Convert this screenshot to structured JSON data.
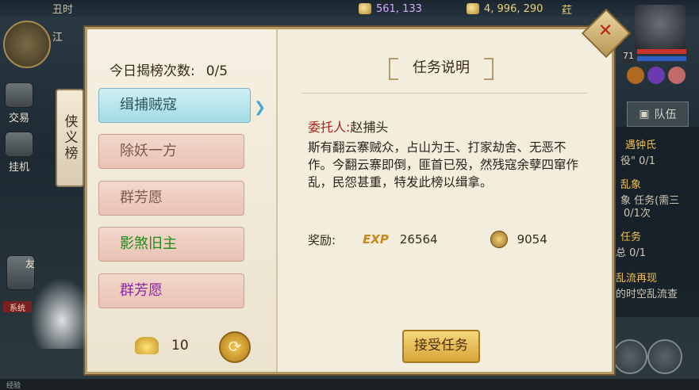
{
  "hud": {
    "clock": "丑时",
    "silver": "561, 133",
    "gold": "4, 996, 290",
    "extra_icon": "荭",
    "location": "江",
    "level": "71",
    "left_buttons": [
      {
        "label": "交易"
      },
      {
        "label": "挂机"
      }
    ],
    "friend_label": "友",
    "system_label": "系统",
    "exp_label": "经验",
    "team_label": "队伍",
    "right_quests": [
      {
        "text": "遇钟氏",
        "hl": true
      },
      {
        "text": "役\" 0/1",
        "hl": false
      },
      {
        "text": "乱象",
        "hl": true
      },
      {
        "text": "象  任务(需三",
        "hl": false
      },
      {
        "text": "0/1次",
        "hl": false
      },
      {
        "text": "任务",
        "hl": true
      },
      {
        "text": "总 0/1",
        "hl": false
      },
      {
        "text": "乱流再现",
        "hl": true
      },
      {
        "text": "的时空乱流查",
        "hl": false
      }
    ]
  },
  "banner": {
    "title": "侠义榜"
  },
  "dialog": {
    "count_label": "今日揭榜次数:",
    "count_value": "0/5",
    "tasks": [
      {
        "label": "缉捕贼寇",
        "state": "active"
      },
      {
        "label": "除妖一方",
        "state": "normal"
      },
      {
        "label": "群芳愿",
        "state": "normal"
      },
      {
        "label": "影煞旧主",
        "state": "green"
      },
      {
        "label": "群芳愿",
        "state": "purple"
      }
    ],
    "ingot_count": "10",
    "section_title": "任务说明",
    "client_key": "委托人:",
    "client_value": "赵捕头",
    "description": "斯有翻云寨贼众，占山为王、打家劫舍、无恶不作。今翻云寨即倒，匪首已殁，然残寇余孽四窜作乱，民怨甚重，特发此榜以缉拿。",
    "reward_label": "奖励:",
    "exp_badge": "EXP",
    "exp_value": "26564",
    "copper_value": "9054",
    "accept_label": "接受任务"
  },
  "icons": {
    "close": "close-icon",
    "refresh": "refresh-icon",
    "ingot": "gold-ingot-icon",
    "copper": "copper-coin-icon"
  },
  "colors": {
    "active_task": "#a5dbe4",
    "normal_task": "#e9c2b4",
    "green_text": "#1f8a1b",
    "purple_text": "#8a2aa0",
    "client_key": "#b0221c"
  }
}
